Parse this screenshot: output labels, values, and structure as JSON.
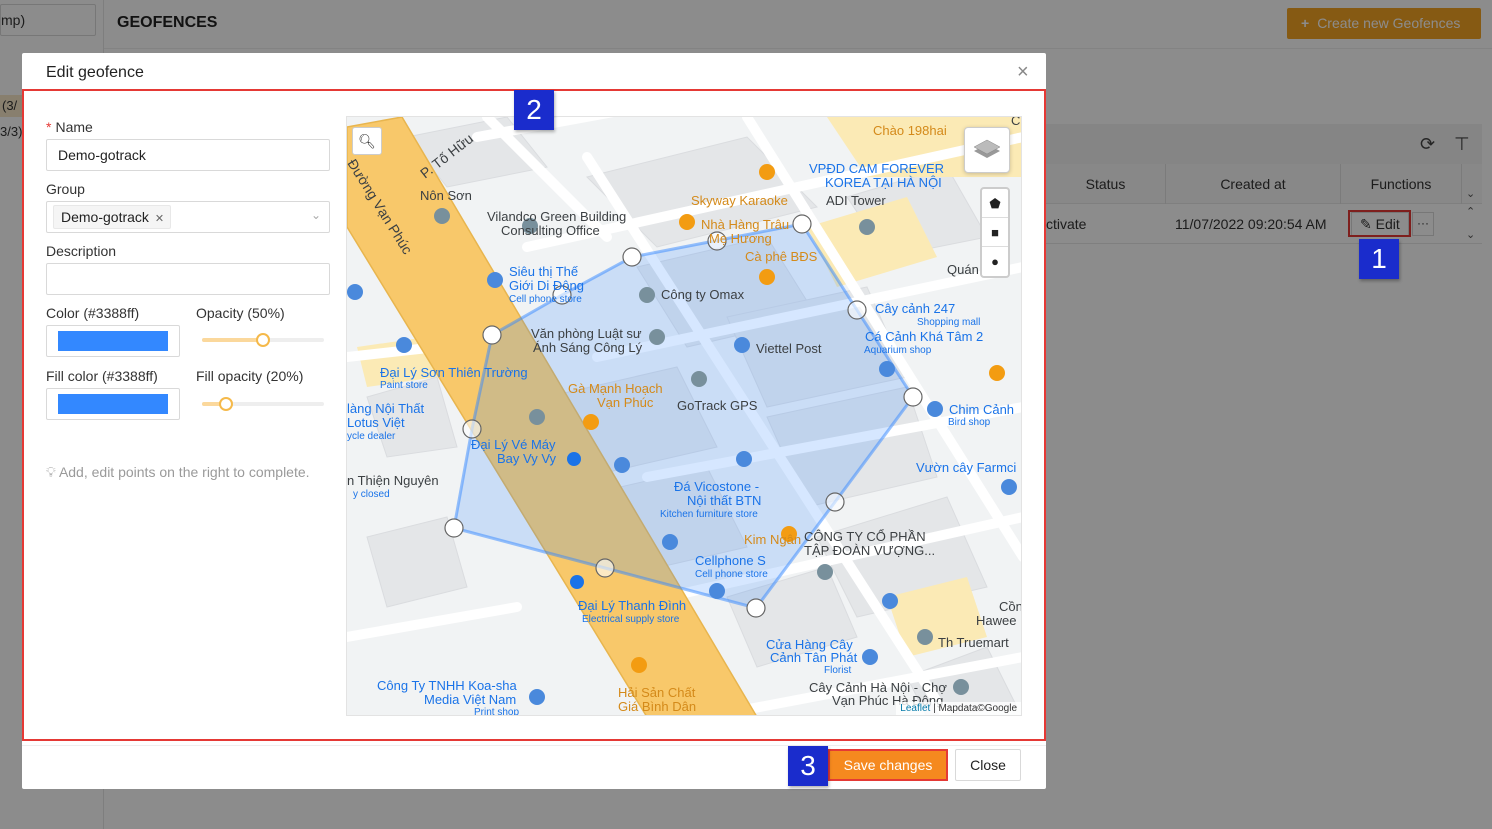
{
  "background": {
    "sidebar_input": "mp)",
    "sidebar_row1": "(3/",
    "sidebar_row2": "3/3)",
    "page_title": "GEOFENCES",
    "create_button": "Create new Geofences",
    "table": {
      "columns": [
        "Status",
        "Created at",
        "Functions"
      ],
      "row": {
        "status": "ctivate",
        "created_at": "11/07/2022 09:20:54 AM",
        "edit_label": "Edit",
        "more_label": "···"
      }
    }
  },
  "modal": {
    "title": "Edit geofence",
    "form": {
      "name_label": "Name",
      "name_value": "Demo-gotrack",
      "group_label": "Group",
      "group_tag": "Demo-gotrack",
      "description_label": "Description",
      "description_value": "",
      "color_label": "Color (#3388ff)",
      "opacity_label": "Opacity (50%)",
      "opacity_value": 0.5,
      "fill_color_label": "Fill color (#3388ff)",
      "fill_opacity_label": "Fill opacity (20%)",
      "fill_opacity_value": 0.2,
      "stroke_color": "#3388ff",
      "fill_color": "#3388ff",
      "hint": "Add, edit points on the right to complete."
    },
    "map": {
      "labels": [
        "Chào 198hai",
        "Chợ lá",
        "P. Tố Hữu",
        "Đường Vạn Phúc",
        "Nôn Sơn",
        "VPĐD CAM FOREVER",
        "KOREA TẠI HÀ NỘI",
        "ADI Tower",
        "Skyway Karaoke",
        "Vilandco Green Building",
        "Consulting Office",
        "Nhà Hàng Trâu",
        "Mẹ Hương",
        "Cà phê BĐS",
        "Siêu thị Thế",
        "Giới Di Động",
        "Cell phone store",
        "Công ty Omax",
        "Văn phòng Luật sư",
        "Ánh Sáng Công Lý",
        "Viettel Post",
        "Cây cảnh 247",
        "Shopping mall",
        "Cá Cảnh Khá Tâm 2",
        "Aquarium shop",
        "Quán",
        "Đại Lý Sơn Thiên Trường",
        "Paint store",
        "Gà Mạnh Hoạch",
        "Vạn Phúc",
        "GoTrack GPS",
        "Chim Cảnh",
        "Bird shop",
        "làng Nội Thất",
        "Lotus Việt",
        "ycle dealer",
        "Đại Lý Vé Máy",
        "Bay Vy Vy",
        "Vườn cây Farmci",
        "n Thiện Nguyên",
        "y closed",
        "Đá Vicostone -",
        "Nội thất BTN",
        "Kitchen furniture store",
        "Kim Ngân",
        "CÔNG TY CỔ PHẦN",
        "TẬP ĐOÀN VƯỢNG...",
        "Cellphone S",
        "Cell phone store",
        "Đại Lý Thanh Đình",
        "Electrical supply store",
        "Cồn",
        "Hawee",
        "Th Truemart",
        "Cửa Hàng Cây",
        "Cảnh Tân Phát",
        "Florist",
        "Công Ty TNHH Koa-sha",
        "Media Việt Nam",
        "Print shop",
        "Hải Sản Chất",
        "Giá Bình Dân",
        "Cây Cảnh Hà Nội - Chợ",
        "Vạn Phúc Hà Đông"
      ],
      "attribution_leaflet": "Leaflet",
      "attribution_rest": "| Mapdata©Google",
      "search_icon": "search-icon",
      "layers_icon": "layers-icon",
      "draw_tools": [
        "pentagon-icon",
        "square-icon",
        "circle-icon"
      ]
    },
    "footer": {
      "save_label": "Save changes",
      "close_label": "Close"
    },
    "close_icon": "×"
  },
  "annotations": [
    "1",
    "2",
    "3"
  ],
  "colors": {
    "accent": "#f5891f",
    "highlight": "#e53935",
    "badge": "#1a2ccc",
    "polygon": "#3388ff"
  }
}
